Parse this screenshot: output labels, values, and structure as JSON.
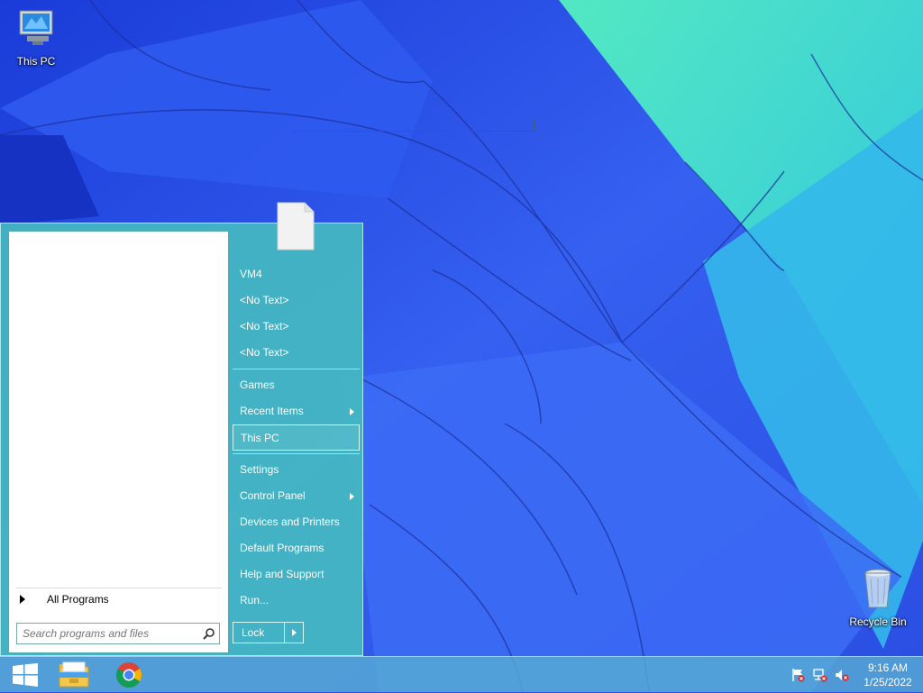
{
  "desktop": {
    "this_pc_label": "This PC",
    "recycle_bin_label": "Recycle Bin"
  },
  "start_menu": {
    "all_programs_label": "All Programs",
    "search_placeholder": "Search programs and files",
    "right_items": [
      {
        "label": "VM4"
      },
      {
        "label": "<No Text>"
      },
      {
        "label": "<No Text>"
      },
      {
        "label": "<No Text>"
      },
      {
        "label": "Games"
      },
      {
        "label": "Recent Items"
      },
      {
        "label": "This PC"
      },
      {
        "label": "Settings"
      },
      {
        "label": "Control Panel"
      },
      {
        "label": "Devices and Printers"
      },
      {
        "label": "Default Programs"
      },
      {
        "label": "Help and Support"
      },
      {
        "label": "Run..."
      }
    ],
    "lock_label": "Lock"
  },
  "taskbar": {
    "time": "9:16 AM",
    "date": "1/25/2022"
  },
  "icons": {
    "start": "windows-logo-icon",
    "explorer": "file-explorer-icon",
    "browser": "chrome-icon",
    "tray": [
      "action-center-flag-icon",
      "network-icon",
      "volume-muted-icon"
    ]
  },
  "colors": {
    "start_menu_bg": "#46bebe",
    "taskbar_bg": "#5aafd2",
    "wallpaper_blue": "#2b52e6"
  }
}
